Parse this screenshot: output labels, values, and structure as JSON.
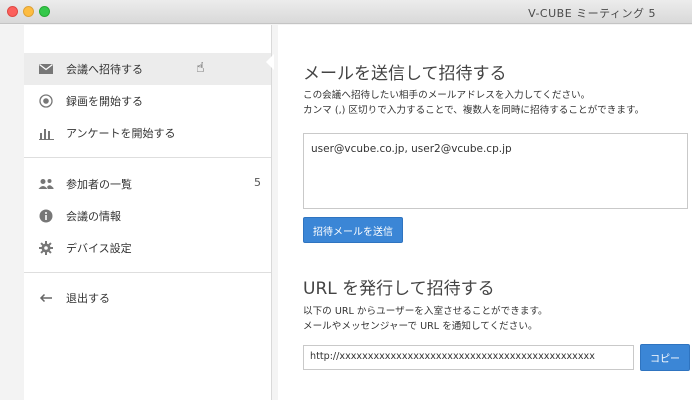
{
  "window": {
    "title": "V-CUBE ミーティング 5"
  },
  "sidebar": {
    "items": [
      {
        "label": "会議へ招待する",
        "icon": "envelope-icon",
        "active": true
      },
      {
        "label": "録画を開始する",
        "icon": "record-icon"
      },
      {
        "label": "アンケートを開始する",
        "icon": "bar-chart-icon"
      },
      {
        "label": "参加者の一覧",
        "icon": "participants-icon",
        "badge": "5"
      },
      {
        "label": "会議の情報",
        "icon": "info-icon"
      },
      {
        "label": "デバイス設定",
        "icon": "gear-icon"
      },
      {
        "label": "退出する",
        "icon": "arrow-left-icon"
      }
    ]
  },
  "main": {
    "email_section": {
      "heading": "メールを送信して招待する",
      "desc_line1": "この会議へ招待したい相手のメールアドレスを入力してください。",
      "desc_line2": "カンマ (,) 区切りで入力することで、複数人を同時に招待することができます。",
      "email_value": "user@vcube.co.jp, user2@vcube.cp.jp",
      "send_button": "招待メールを送信"
    },
    "url_section": {
      "heading": "URL を発行して招待する",
      "desc_line1": "以下の URL からユーザーを入室させることができます。",
      "desc_line2": "メールやメッセンジャーで URL を通知してください。",
      "url_value": "http://xxxxxxxxxxxxxxxxxxxxxxxxxxxxxxxxxxxxxxxxxxxxx",
      "copy_button": "コピー"
    }
  },
  "colors": {
    "accent": "#3b86d6",
    "active_item": "#ececec"
  }
}
